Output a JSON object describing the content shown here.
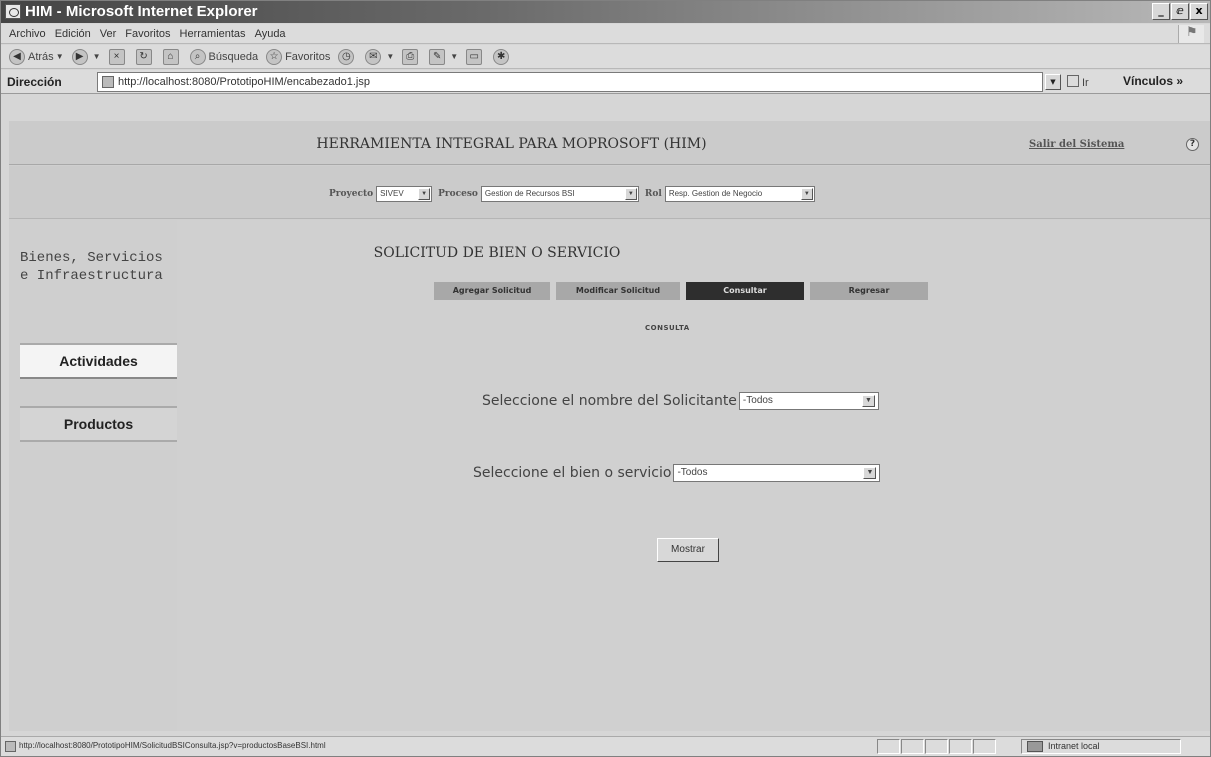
{
  "window": {
    "title": "HIM - Microsoft Internet Explorer",
    "controls": {
      "minimize": "_",
      "maximize": "ⅇ",
      "close": "x"
    }
  },
  "menubar": {
    "items": [
      "Archivo",
      "Edición",
      "Ver",
      "Favoritos",
      "Herramientas",
      "Ayuda"
    ]
  },
  "toolbar": {
    "back": "Atrás",
    "search": "Búsqueda",
    "favorites": "Favoritos"
  },
  "addressbar": {
    "label": "Dirección",
    "url": "http://localhost:8080/PrototipoHIM/encabezado1.jsp",
    "go": "Ir",
    "links": "Vínculos »"
  },
  "header": {
    "app_title": "HERRAMIENTA INTEGRAL PARA MOPROSOFT (HIM)",
    "logout": "Salir del Sistema"
  },
  "selectors": {
    "project_label": "Proyecto",
    "project_value": "SIVEV",
    "process_label": "Proceso",
    "process_value": "Gestion de Recursos BSI",
    "role_label": "Rol",
    "role_value": "Resp. Gestion de Negocio"
  },
  "sidebar": {
    "section_title_line1": "Bienes, Servicios",
    "section_title_line2": "e Infraestructura",
    "activities": "Actividades",
    "products": "Productos"
  },
  "main": {
    "form_title": "SOLICITUD DE BIEN O SERVICIO",
    "tabs": [
      "Agregar Solicitud",
      "Modificar Solicitud",
      "Consultar",
      "Regresar"
    ],
    "section_label": "CONSULTA",
    "requester_label": "Seleccione el nombre del Solicitante",
    "requester_value": "-Todos",
    "item_label": "Seleccione el bien o servicio",
    "item_value": "-Todos",
    "show_button": "Mostrar"
  },
  "statusbar": {
    "url": "http://localhost:8080/PrototipoHIM/SolicitudBSIConsulta.jsp?v=productosBaseBSI.html",
    "zone": "Intranet local"
  }
}
